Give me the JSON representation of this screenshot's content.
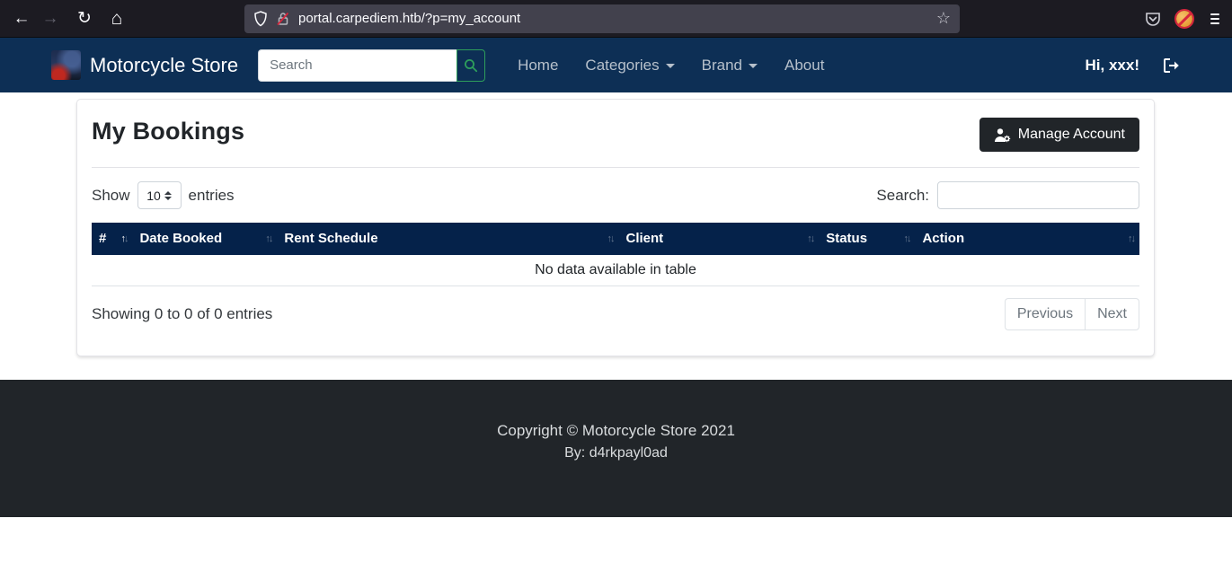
{
  "browser": {
    "url": "portal.carpediem.htb/?p=my_account"
  },
  "navbar": {
    "brand": "Motorcycle Store",
    "search_placeholder": "Search",
    "links": [
      {
        "label": "Home",
        "dropdown": false
      },
      {
        "label": "Categories",
        "dropdown": true
      },
      {
        "label": "Brand",
        "dropdown": true
      },
      {
        "label": "About",
        "dropdown": false
      }
    ],
    "greeting": "Hi, xxx!"
  },
  "main": {
    "title": "My Bookings",
    "manage_account_label": "Manage Account",
    "length_control": {
      "show_label": "Show",
      "value": "10",
      "entries_label": "entries"
    },
    "search_label": "Search:",
    "search_value": "",
    "table": {
      "columns": [
        "#",
        "Date Booked",
        "Rent Schedule",
        "Client",
        "Status",
        "Action"
      ],
      "sorted_column": "#",
      "sorted_direction": "ascending",
      "rows": [],
      "empty_message": "No data available in table"
    },
    "info": "Showing 0 to 0 of 0 entries",
    "pagination": {
      "previous": "Previous",
      "next": "Next"
    }
  },
  "footer": {
    "copyright": "Copyright © Motorcycle Store 2021",
    "author": "By: d4rkpayl0ad"
  },
  "colors": {
    "navbar_bg": "#0d2f55",
    "table_header_bg": "#05224a",
    "success_green": "#2e9e5b",
    "dark_button": "#212529",
    "footer_bg": "#212529",
    "chrome_bg": "#1c1b22",
    "urlbar_bg": "#42414d",
    "insecure_slash": "#d7263d"
  }
}
